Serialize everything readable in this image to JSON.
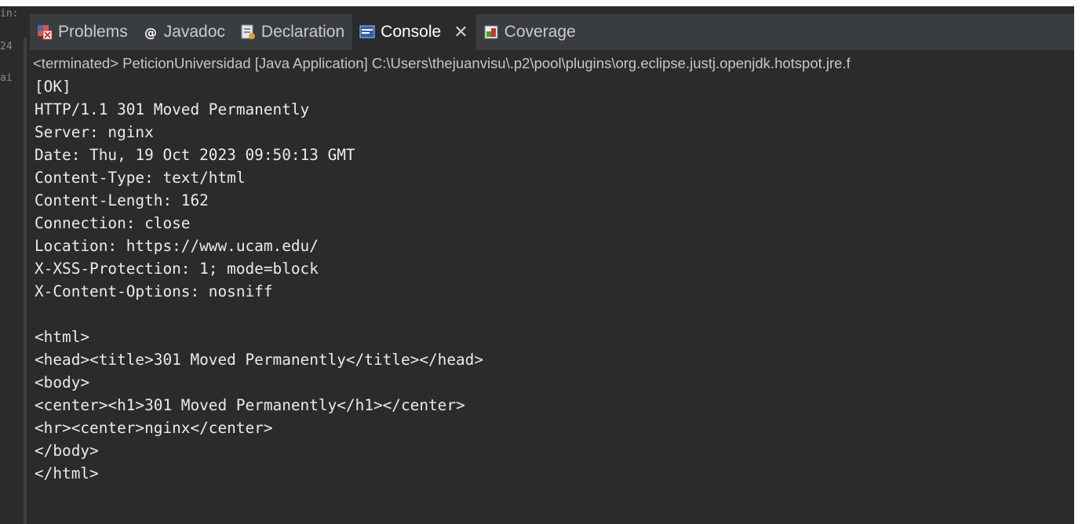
{
  "gutter": {
    "fragments": [
      "in:",
      "24",
      "ai"
    ]
  },
  "tabs": [
    {
      "label": "Problems",
      "icon": "problems-icon",
      "active": false
    },
    {
      "label": "Javadoc",
      "icon": "javadoc-icon",
      "active": false
    },
    {
      "label": "Declaration",
      "icon": "declaration-icon",
      "active": false
    },
    {
      "label": "Console",
      "icon": "console-icon",
      "active": true
    },
    {
      "label": "Coverage",
      "icon": "coverage-icon",
      "active": false
    }
  ],
  "status": "<terminated> PeticionUniversidad [Java Application] C:\\Users\\thejuanvisu\\.p2\\pool\\plugins\\org.eclipse.justj.openjdk.hotspot.jre.f",
  "console_lines": [
    "[OK]",
    "HTTP/1.1 301 Moved Permanently",
    "Server: nginx",
    "Date: Thu, 19 Oct 2023 09:50:13 GMT",
    "Content-Type: text/html",
    "Content-Length: 162",
    "Connection: close",
    "Location: https://www.ucam.edu/",
    "X-XSS-Protection: 1; mode=block",
    "X-Content-Options: nosniff",
    "",
    "<html>",
    "<head><title>301 Moved Permanently</title></head>",
    "<body>",
    "<center><h1>301 Moved Permanently</h1></center>",
    "<hr><center>nginx</center>",
    "</body>",
    "</html>"
  ],
  "colors": {
    "background": "#2b2b2b",
    "tabbar": "#3a3d3f",
    "text": "#ebebeb"
  }
}
